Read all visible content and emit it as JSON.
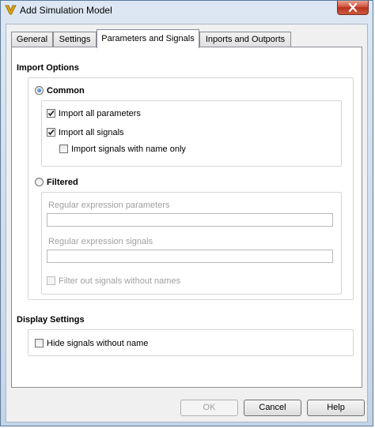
{
  "window": {
    "title": "Add Simulation Model"
  },
  "tabs": [
    {
      "label": "General",
      "active": false
    },
    {
      "label": "Settings",
      "active": false
    },
    {
      "label": "Parameters and Signals",
      "active": true
    },
    {
      "label": "Inports and Outports",
      "active": false
    }
  ],
  "import_options": {
    "title": "Import Options",
    "common": {
      "label": "Common",
      "selected": true,
      "import_all_parameters": {
        "label": "Import all parameters",
        "checked": true
      },
      "import_all_signals": {
        "label": "Import all signals",
        "checked": true
      },
      "import_signals_with_name_only": {
        "label": "Import signals with name only",
        "checked": false
      }
    },
    "filtered": {
      "label": "Filtered",
      "selected": false,
      "regex_parameters": {
        "label": "Regular expression parameters",
        "value": ""
      },
      "regex_signals": {
        "label": "Regular expression signals",
        "value": ""
      },
      "filter_out_unnamed": {
        "label": "Filter out signals without names",
        "checked": false,
        "enabled": false
      }
    }
  },
  "display_settings": {
    "title": "Display Settings",
    "hide_signals_without_name": {
      "label": "Hide signals without name",
      "checked": false
    }
  },
  "buttons": {
    "ok": "OK",
    "cancel": "Cancel",
    "help": "Help"
  },
  "colors": {
    "accent_radio": "#1c5fb0",
    "close_button": "#c8432a"
  },
  "icons": {
    "app": "app-logo-icon",
    "close": "close-icon",
    "check": "checkmark-icon"
  }
}
